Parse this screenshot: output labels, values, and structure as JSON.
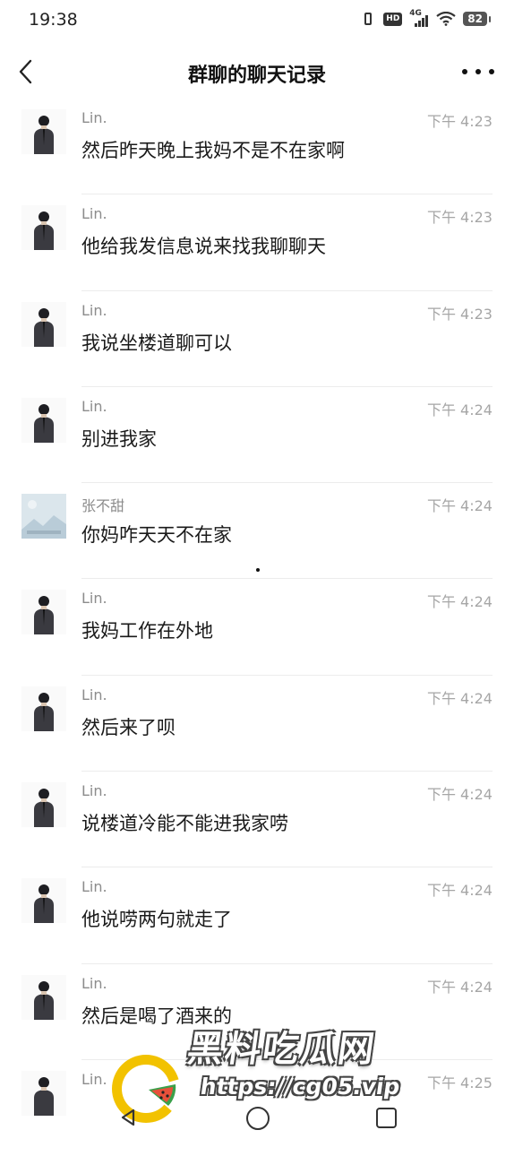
{
  "status_bar": {
    "time": "19:38",
    "network": "4G",
    "hd": "HD",
    "battery": "82"
  },
  "header": {
    "title": "群聊的聊天记录"
  },
  "messages": [
    {
      "name": "Lin.",
      "time": "下午 4:23",
      "text": "然后昨天晚上我妈不是不在家啊",
      "avatar": "lin-avatar"
    },
    {
      "name": "Lin.",
      "time": "下午 4:23",
      "text": "他给我发信息说来找我聊聊天",
      "avatar": "lin-avatar"
    },
    {
      "name": "Lin.",
      "time": "下午 4:23",
      "text": "我说坐楼道聊可以",
      "avatar": "lin-avatar"
    },
    {
      "name": "Lin.",
      "time": "下午 4:24",
      "text": "别进我家",
      "avatar": "lin-avatar"
    },
    {
      "name": "张不甜",
      "time": "下午 4:24",
      "text": "你妈咋天天不在家",
      "avatar": "zhang-avatar"
    },
    {
      "name": "Lin.",
      "time": "下午 4:24",
      "text": "我妈工作在外地",
      "avatar": "lin-avatar"
    },
    {
      "name": "Lin.",
      "time": "下午 4:24",
      "text": "然后来了呗",
      "avatar": "lin-avatar"
    },
    {
      "name": "Lin.",
      "time": "下午 4:24",
      "text": "说楼道冷能不能进我家唠",
      "avatar": "lin-avatar"
    },
    {
      "name": "Lin.",
      "time": "下午 4:24",
      "text": "他说唠两句就走了",
      "avatar": "lin-avatar"
    },
    {
      "name": "Lin.",
      "time": "下午 4:24",
      "text": "然后是喝了酒来的",
      "avatar": "lin-avatar"
    },
    {
      "name": "Lin.",
      "time": "下午 4:25",
      "text": "",
      "avatar": "lin-avatar"
    }
  ],
  "watermark": {
    "title": "黑料吃瓜网",
    "url": "https://cg05.vip"
  },
  "colors": {
    "name": "#8c8c8c",
    "time": "#a6a6a6",
    "divider": "#ececec",
    "text": "#1a1a1a"
  }
}
